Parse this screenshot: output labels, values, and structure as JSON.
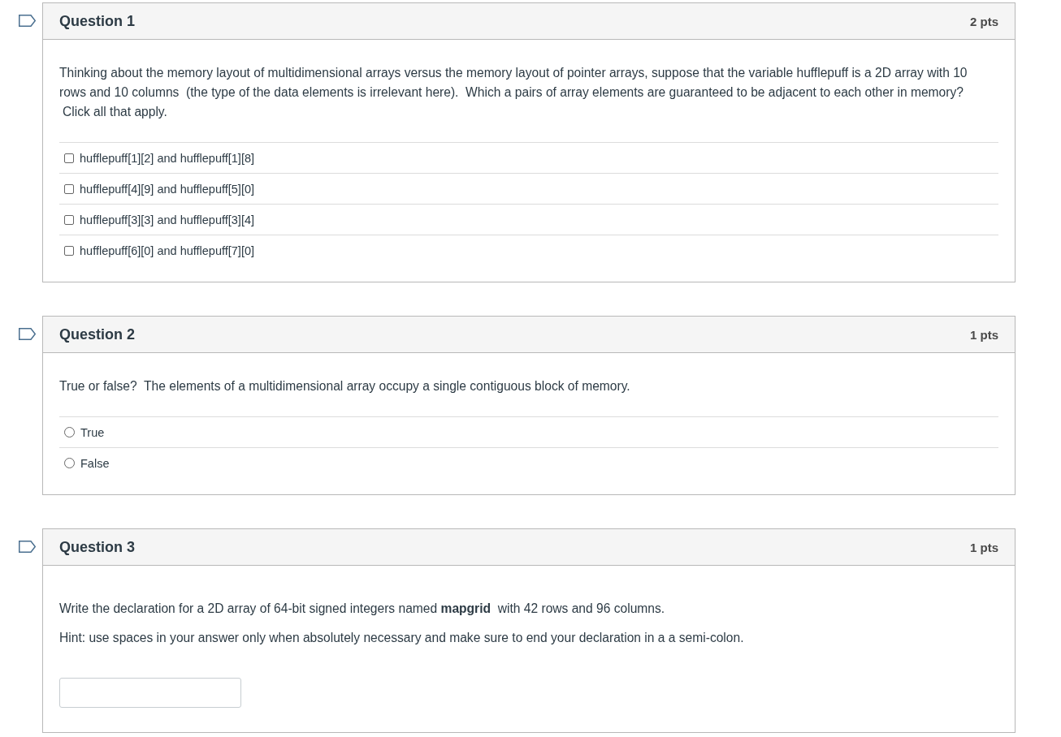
{
  "questions": [
    {
      "kind": "multiple_answers",
      "title": "Question 1",
      "points": "2 pts",
      "flagged": false,
      "paragraphs": [
        "Thinking about the memory layout of multidimensional arrays versus the memory layout of pointer arrays, suppose that the variable hufflepuff is a 2D array with 10 rows and 10 columns  (the type of the data elements is irrelevant here).  Which a pairs of array elements are guaranteed to be adjacent to each other in memory?"
      ],
      "instruction": "Click all that apply.",
      "answers": [
        {
          "label": "hufflepuff[1][2] and hufflepuff[1][8]",
          "checked": false
        },
        {
          "label": "hufflepuff[4][9] and hufflepuff[5][0]",
          "checked": false
        },
        {
          "label": "hufflepuff[3][3] and hufflepuff[3][4]",
          "checked": false
        },
        {
          "label": "hufflepuff[6][0] and hufflepuff[7][0]",
          "checked": false
        }
      ]
    },
    {
      "kind": "true_false",
      "title": "Question 2",
      "points": "1 pts",
      "flagged": false,
      "paragraphs": [
        "True or false?  The elements of a multidimensional array occupy a single contiguous block of memory."
      ],
      "answers": [
        {
          "label": "True",
          "selected": false
        },
        {
          "label": "False",
          "selected": false
        }
      ]
    },
    {
      "kind": "short_answer",
      "title": "Question 3",
      "points": "1 pts",
      "flagged": false,
      "paragraphs": [
        "Write the declaration for a 2D array of 64-bit signed integers named **mapgrid**  with 42 rows and 96 columns.",
        "Hint: use spaces in your answer only when absolutely necessary and make sure to end your declaration in a a semi-colon."
      ]
    }
  ]
}
